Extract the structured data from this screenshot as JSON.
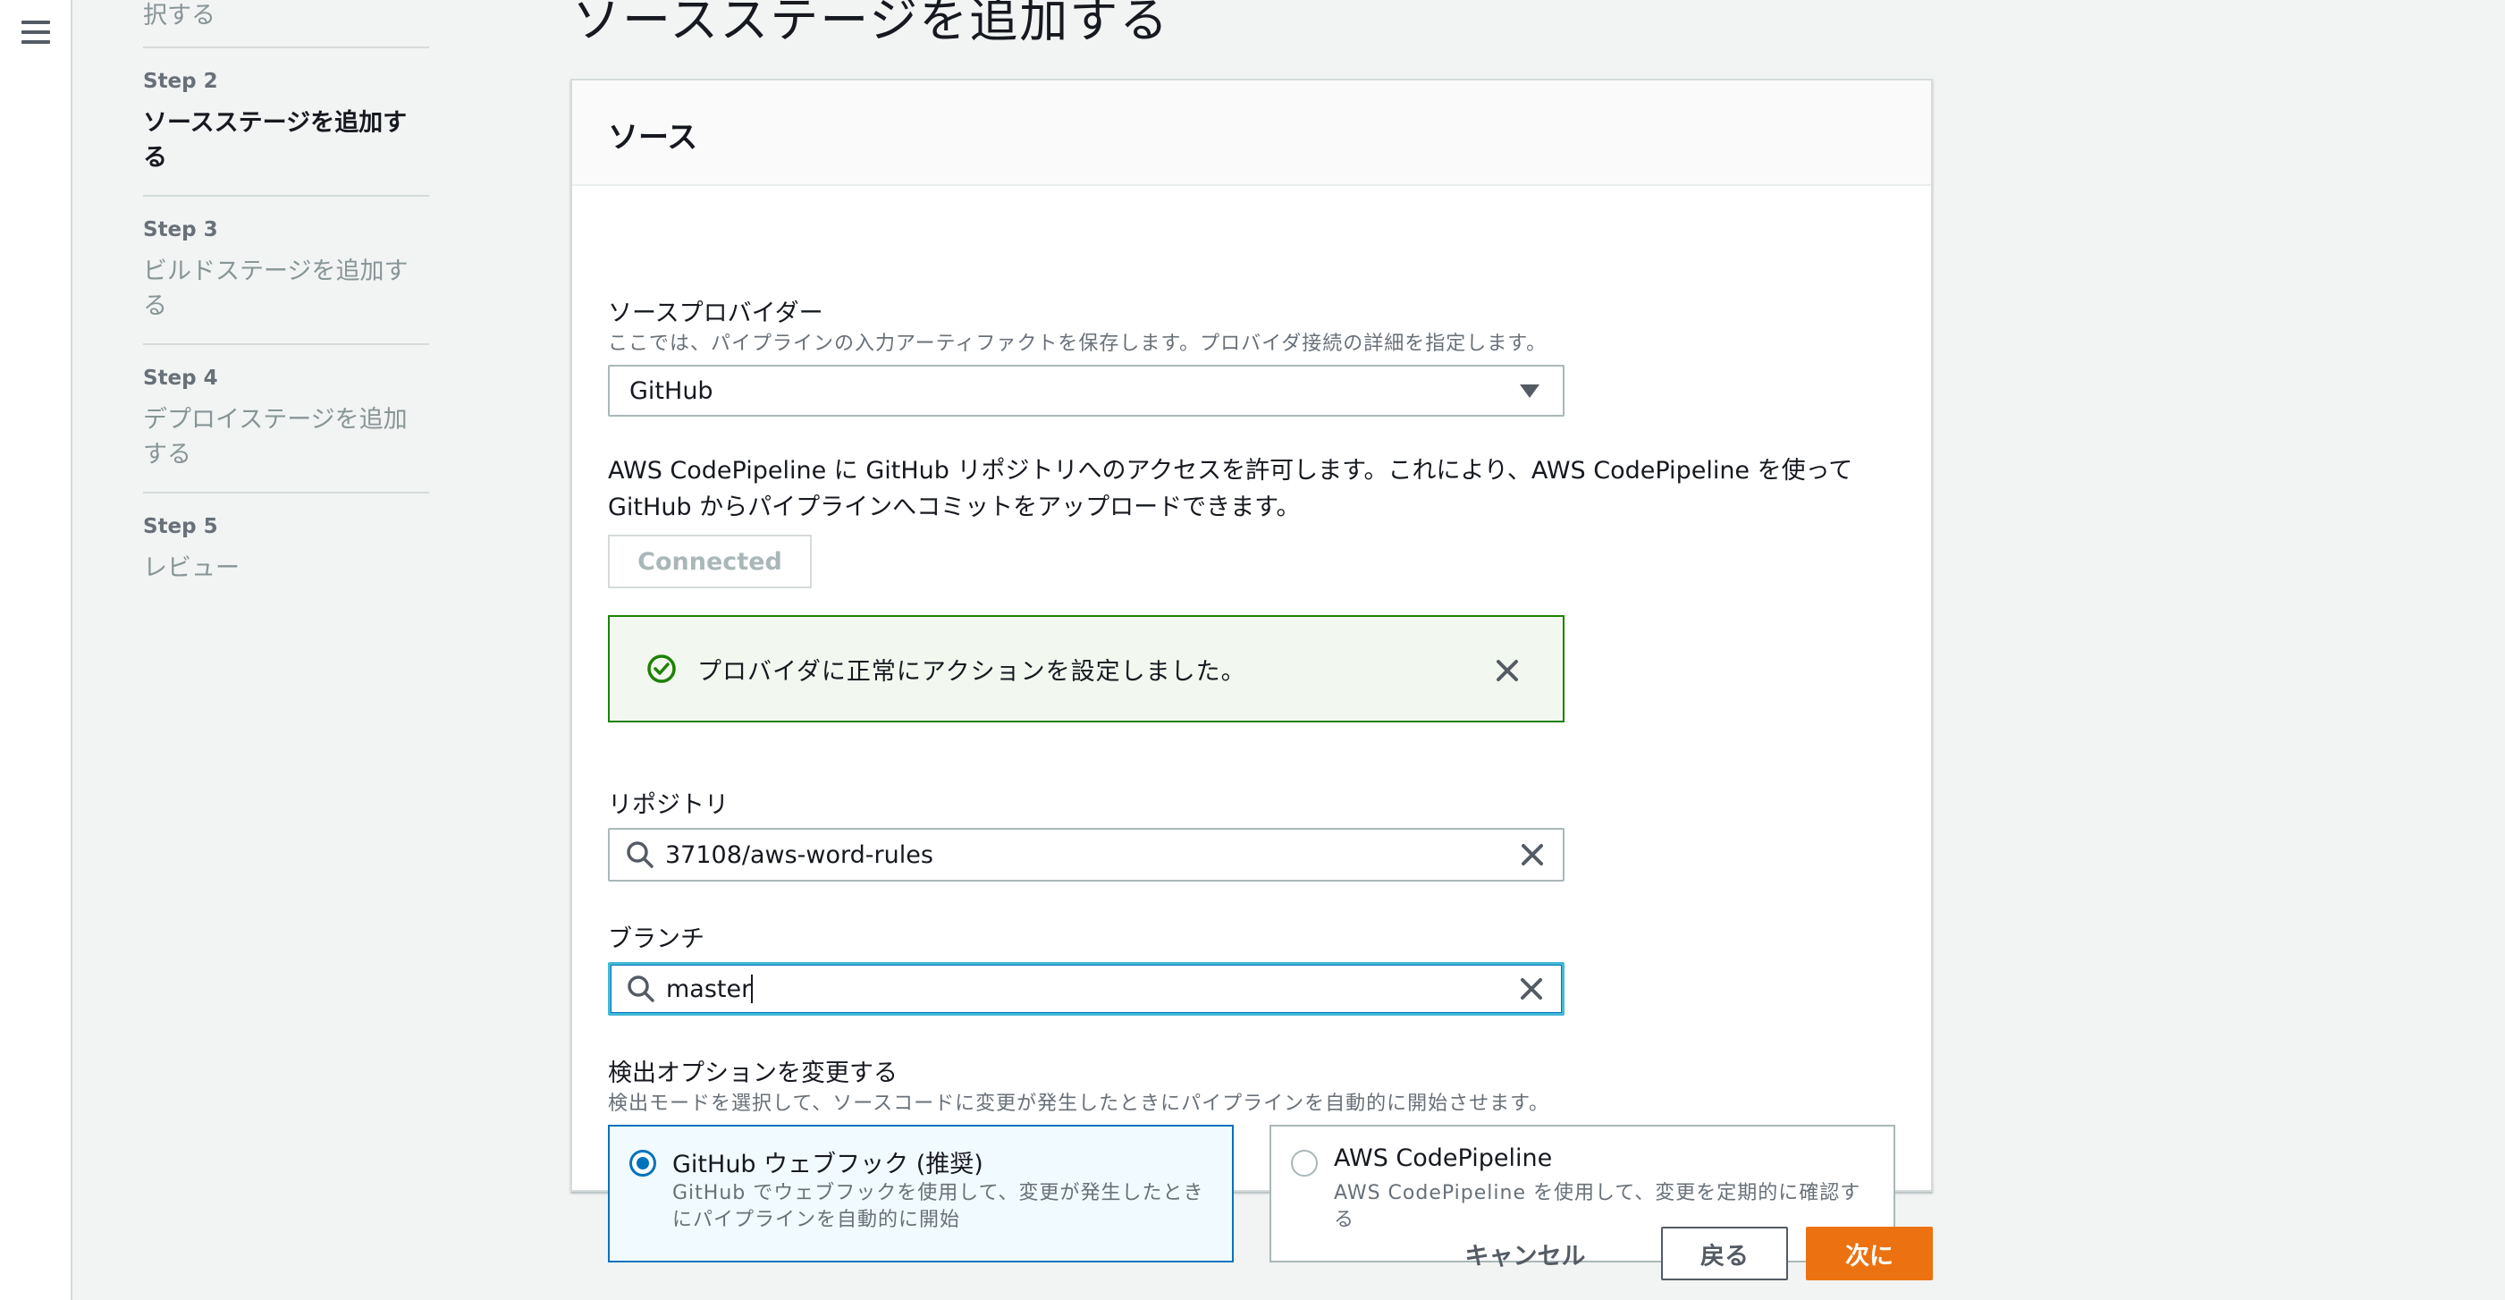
{
  "nav": {
    "menu_icon": "hamburger-menu-icon",
    "steps": [
      {
        "label": "",
        "title": "択する",
        "state": "done"
      },
      {
        "label": "Step 2",
        "title": "ソースステージを追加する",
        "state": "active"
      },
      {
        "label": "Step 3",
        "title": "ビルドステージを追加する",
        "state": "pending"
      },
      {
        "label": "Step 4",
        "title": "デプロイステージを追加する",
        "state": "pending"
      },
      {
        "label": "Step 5",
        "title": "レビュー",
        "state": "pending"
      }
    ]
  },
  "page": {
    "title": "ソースステージを追加する"
  },
  "source": {
    "header": "ソース",
    "provider": {
      "label": "ソースプロバイダー",
      "description": "ここでは、パイプラインの入力アーティファクトを保存します。プロバイダ接続の詳細を指定します。",
      "value": "GitHub"
    },
    "info_line1": "AWS CodePipeline に GitHub リポジトリへのアクセスを許可します。これにより、AWS CodePipeline を使って",
    "info_line2": "GitHub からパイプラインへコミットをアップロードできます。",
    "connected_label": "Connected",
    "flash": {
      "message": "プロバイダに正常にアクションを設定しました。",
      "icon": "check-circle-icon",
      "color": "#1d8102"
    },
    "repository": {
      "label": "リポジトリ",
      "value": "37108/aws-word-rules"
    },
    "branch": {
      "label": "ブランチ",
      "value": "master"
    },
    "detection": {
      "label": "検出オプションを変更する",
      "description": "検出モードを選択して、ソースコードに変更が発生したときにパイプラインを自動的に開始させます。",
      "options": [
        {
          "title": "GitHub ウェブフック (推奨)",
          "desc": "GitHub でウェブフックを使用して、変更が発生したときにパイプラインを自動的に開始",
          "selected": true
        },
        {
          "title": "AWS CodePipeline",
          "desc": "AWS CodePipeline を使用して、変更を定期的に確認する",
          "selected": false
        }
      ]
    }
  },
  "footer": {
    "cancel": "キャンセル",
    "back": "戻る",
    "next": "次に"
  },
  "colors": {
    "accent": "#ec7211",
    "focus": "#44b9d6",
    "selected": "#0073bb",
    "success": "#1d8102"
  }
}
